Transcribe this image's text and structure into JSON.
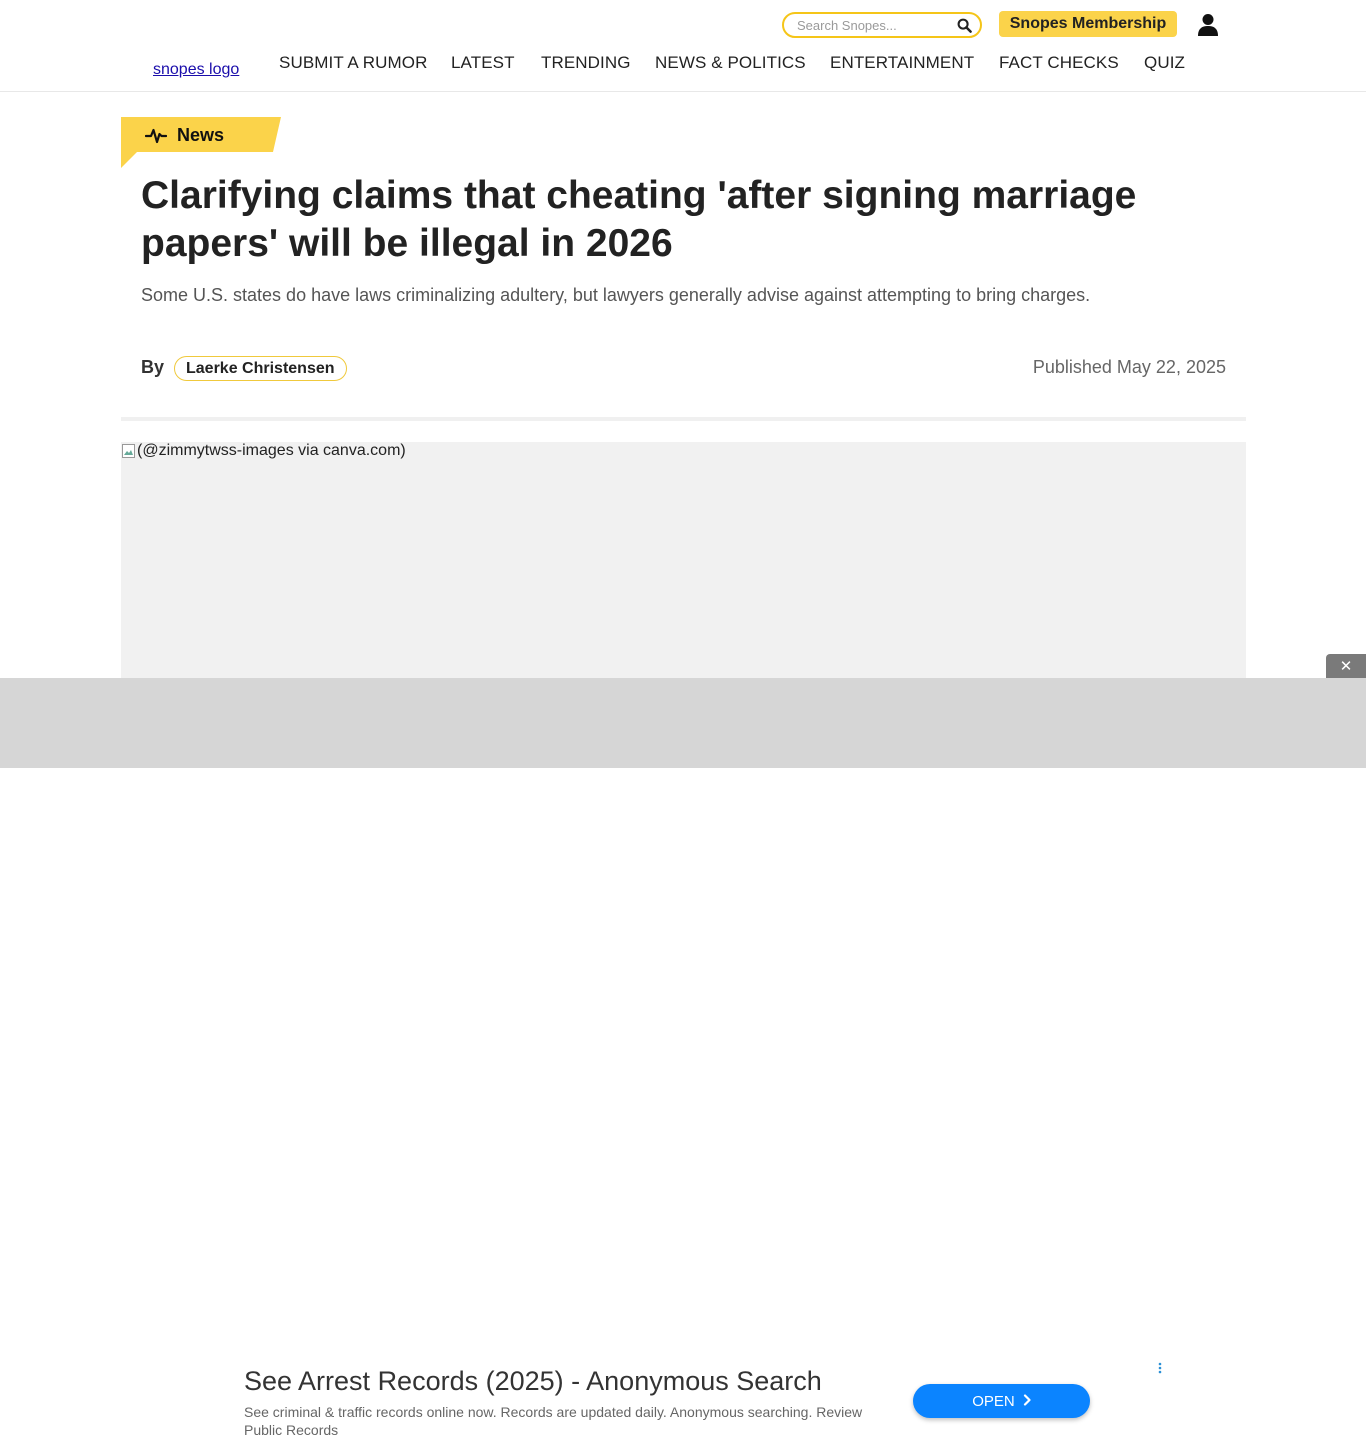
{
  "header": {
    "search_placeholder": "Search Snopes...",
    "membership_label": "Snopes Membership",
    "logo_alt": "snopes logo",
    "nav": [
      {
        "label": "SUBMIT A RUMOR"
      },
      {
        "label": "LATEST"
      },
      {
        "label": "TRENDING"
      },
      {
        "label": "NEWS & POLITICS"
      },
      {
        "label": "ENTERTAINMENT"
      },
      {
        "label": "FACT CHECKS"
      },
      {
        "label": "QUIZ"
      }
    ]
  },
  "article": {
    "category": "News",
    "title": "Clarifying claims that cheating 'after signing marriage papers' will be illegal in 2026",
    "subtitle": "Some U.S. states do have laws criminalizing adultery, but lawyers generally advise against attempting to bring charges.",
    "by_label": "By",
    "author": "Laerke Christensen",
    "published": "Published May 22, 2025",
    "hero_alt": "(@zimmytwss-images via canva.com)"
  },
  "ad": {
    "title": "See Arrest Records (2025) - Anonymous Search",
    "description": "See criminal & traffic records online now. Records are updated daily. Anonymous searching. Review Public Records",
    "button_label": "OPEN",
    "close_symbol": "✕"
  },
  "colors": {
    "accent_yellow": "#fbd34a",
    "ad_button_blue": "#0b84ff",
    "text_dark": "#222222"
  },
  "icons": [
    "search-icon",
    "user-icon",
    "pulse-icon",
    "chevron-right-icon",
    "close-icon",
    "info-icon"
  ]
}
